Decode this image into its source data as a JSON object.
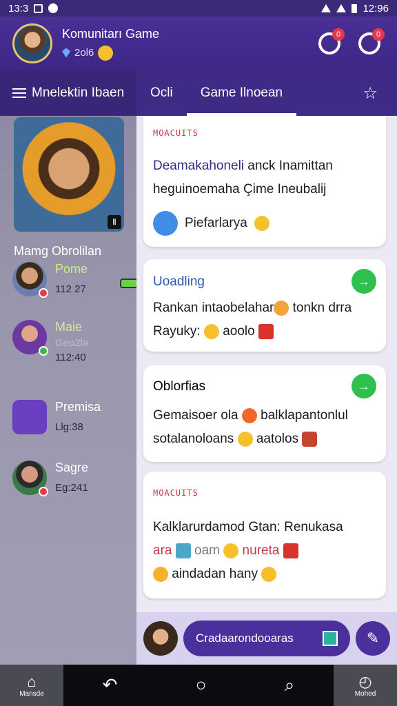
{
  "status": {
    "time_left": "13:3",
    "time_right": "12:96"
  },
  "header": {
    "title": "Komunitarı Game",
    "subtitle": "2ol6",
    "notif_badge": "0",
    "chat_badge": "0"
  },
  "tabs": {
    "menu_label": "Mnelektin Ibaen",
    "tab1": "Ocli",
    "tab2": "Game Ilnoean",
    "star_icon": "star-icon"
  },
  "sidebar": {
    "hero_tag": "Ⅱ",
    "title": "Mamg Obrolilan",
    "chats": [
      {
        "name": "Pome",
        "time": "112 27",
        "name_color": "#c7f08a"
      },
      {
        "name": "Maie",
        "sub": "Geo2lə",
        "time": "112:40",
        "name_color": "#d6e7a0"
      },
      {
        "name": "Premisa",
        "time": "Llg:38",
        "name_color": "#ffffff"
      },
      {
        "name": "Sagre",
        "time": "Eg:241",
        "name_color": "#ffffff"
      }
    ]
  },
  "cards": [
    {
      "kicker": "MOACUITS",
      "headline": "Deamakahoneli",
      "headline_rest": " anck Inamittan",
      "body": "heguinoemaha Çime Ineubalij",
      "foot": "Piefarlarya"
    },
    {
      "kicker": "Uoadling",
      "body1": "Rankan intaobelahar",
      "body1b": " tonkn drra",
      "body2": "Rayuky: ",
      "body2b": "aoolo"
    },
    {
      "title": "Oblorfias",
      "body1": "Gemaisoer ola",
      "body1b": " balklapantonlul",
      "body2": "sotalanoloans",
      "body2b": " aatolos"
    },
    {
      "kicker": "MOACUITS",
      "body0": "Kalklarurdamod Gtan: Renukasa",
      "body1": "ara",
      "body1b": " oam",
      "body1c": " nureta",
      "body2": " aindadan hany"
    }
  ],
  "composer": {
    "placeholder": "Cradaarondooaras"
  },
  "nav": {
    "home_label": "Mansde",
    "right_label": "Mohed"
  }
}
